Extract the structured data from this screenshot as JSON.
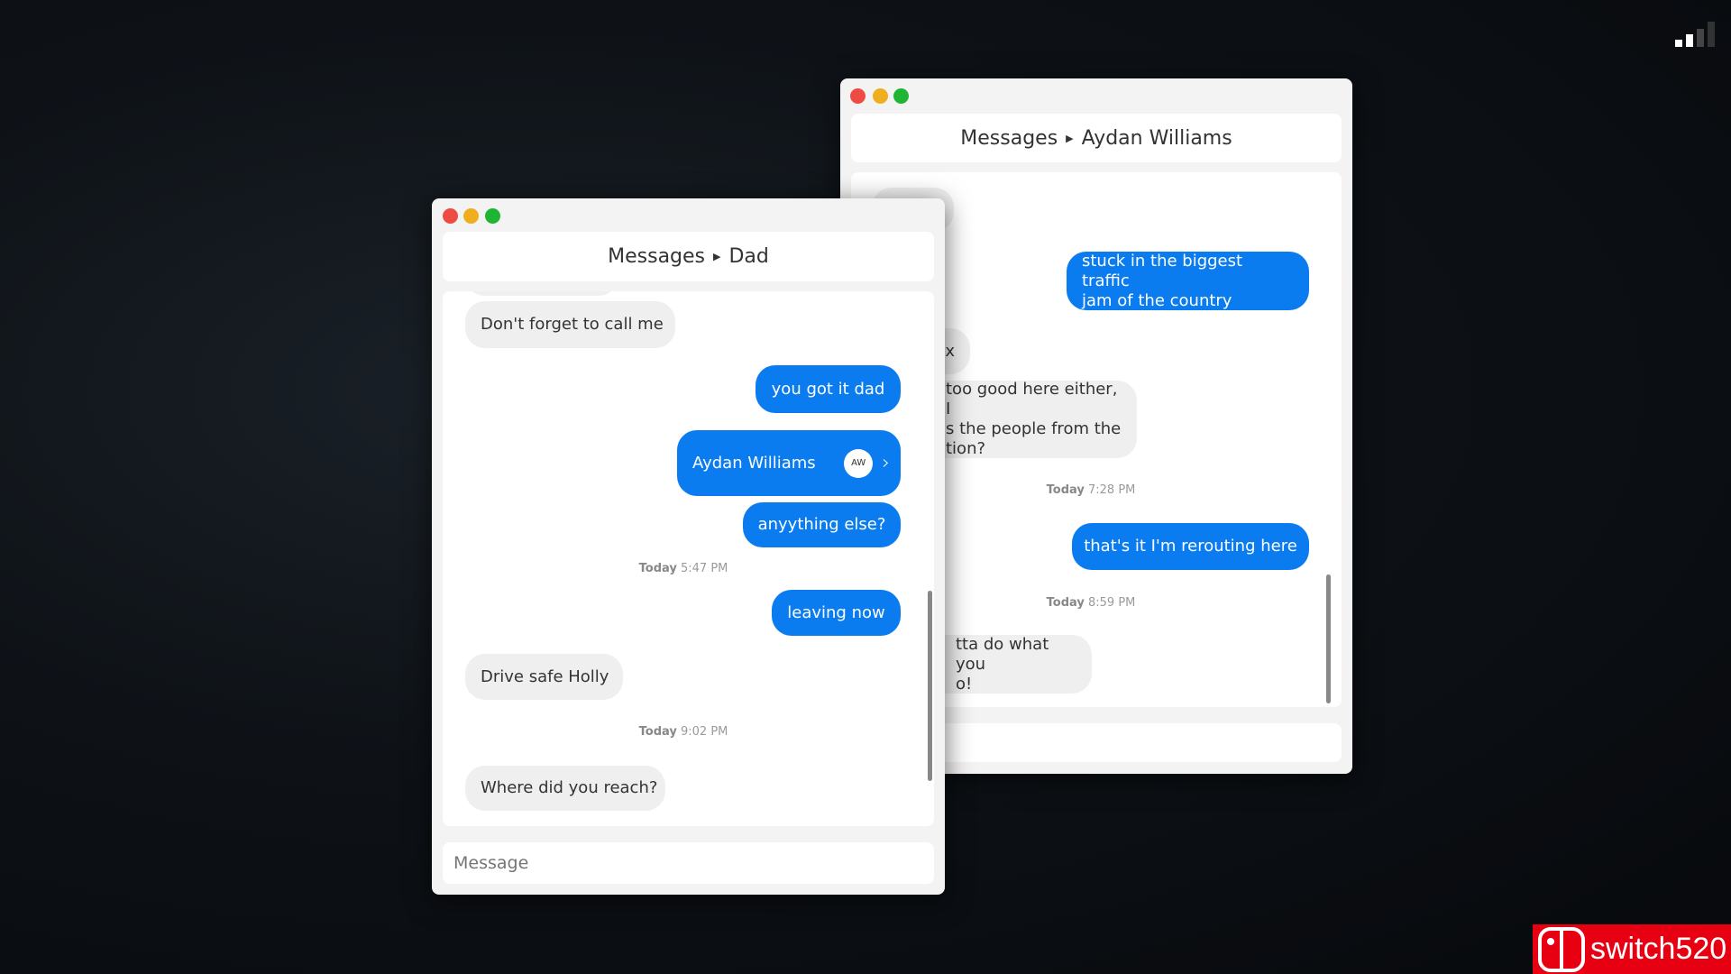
{
  "back_window": {
    "title_app": "Messages",
    "title_contact": "Aydan Williams",
    "messages": [
      {
        "type": "out",
        "text": "stuck in the biggest traffic\njam of the country"
      },
      {
        "type": "in",
        "text": "x"
      },
      {
        "type": "in",
        "text": "too good here either, I\ns the people from the\ntion?"
      },
      {
        "type": "timestamp",
        "day": "Today",
        "time": "7:28 PM"
      },
      {
        "type": "out",
        "text": "that's it I'm rerouting here"
      },
      {
        "type": "timestamp",
        "day": "Today",
        "time": "8:59 PM"
      },
      {
        "type": "in",
        "text": "tta do what you\no!"
      }
    ]
  },
  "front_window": {
    "title_app": "Messages",
    "title_contact": "Dad",
    "messages": [
      {
        "type": "in",
        "text": "Don't forget to call me"
      },
      {
        "type": "out",
        "text": "you got it dad"
      },
      {
        "type": "contact_card",
        "name": "Aydan Williams",
        "initials": "AW"
      },
      {
        "type": "out",
        "text": "anyything else?"
      },
      {
        "type": "timestamp",
        "day": "Today",
        "time": "5:47 PM"
      },
      {
        "type": "out",
        "text": "leaving now"
      },
      {
        "type": "in",
        "text": "Drive safe Holly"
      },
      {
        "type": "timestamp",
        "day": "Today",
        "time": "9:02 PM"
      },
      {
        "type": "in",
        "text": "Where did you reach?"
      }
    ],
    "input_placeholder": "Message"
  },
  "watermark": {
    "text": "switch520",
    "color": "#e60012"
  },
  "colors": {
    "bubble_out": "#0a7cf0",
    "bubble_in": "#efefef",
    "close": "#ee4b43",
    "minimize": "#f0ad1d",
    "zoom": "#1fb534"
  },
  "icons": {
    "signal": "signal-bars-icon",
    "chevron": "chevron-right-icon",
    "logo": "nintendo-switch-logo-icon"
  }
}
